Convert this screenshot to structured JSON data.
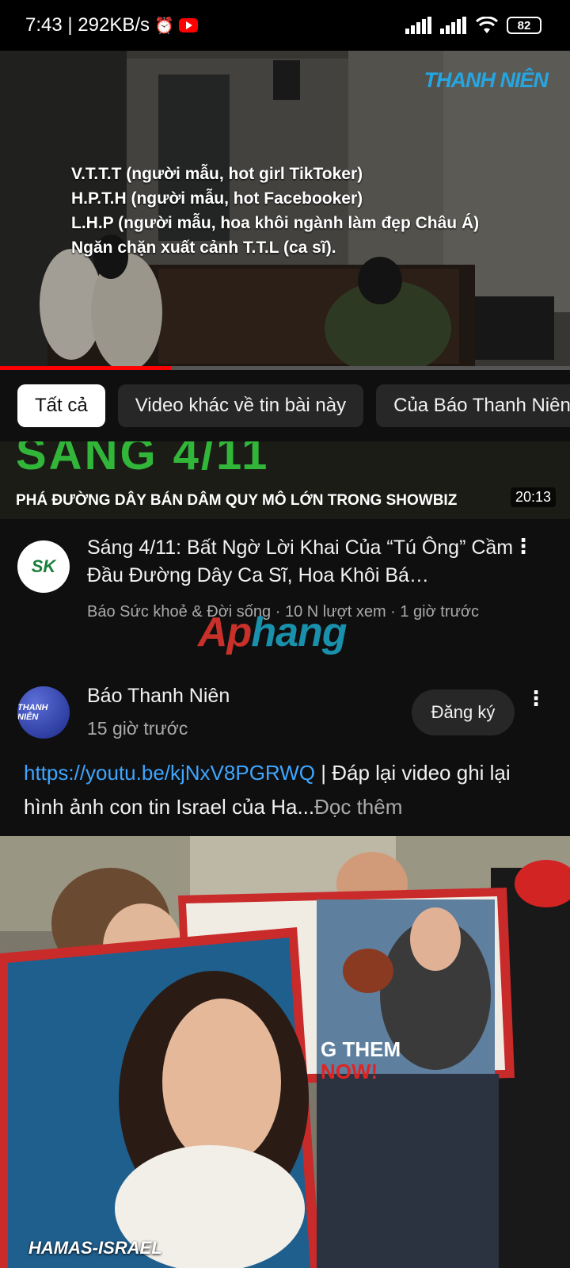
{
  "status_bar": {
    "time_speed": "7:43 | 292KB/s",
    "alarm_icon": "⏰",
    "signal_1": "▂▄▆█",
    "signal_2": "▂▄▆█",
    "wifi_icon": "📶",
    "battery": "82"
  },
  "player": {
    "brand": "THANH NIÊN",
    "overlay_lines": [
      "V.T.T.T (người mẫu, hot girl TikToker)",
      "H.P.T.H (người mẫu, hot Facebooker)",
      "L.H.P (người mẫu, hoa khôi ngành làm đẹp Châu Á)",
      "Ngăn chặn xuất cảnh T.T.L (ca sĩ)."
    ],
    "progress_fraction": 0.3
  },
  "chips": [
    {
      "label": "Tất cả",
      "active": true
    },
    {
      "label": "Video khác về tin bài này",
      "active": false
    },
    {
      "label": "Của Báo Thanh Niên",
      "active": false
    }
  ],
  "thumbnail": {
    "title": "SÁNG 4/11",
    "subtitle": "PHÁ ĐƯỜNG DÂY BÁN DÂM QUY MÔ LỚN TRONG SHOWBIZ",
    "duration": "20:13"
  },
  "video": {
    "channel_avatar": "SK",
    "title": "Sáng 4/11: Bất Ngờ Lời Khai Của “Tú Ông” Cầm Đầu Đường Dây Ca Sĩ, Hoa Khôi Bá…",
    "meta": "Báo Sức khoẻ & Đời sống · 10 N lượt xem · 1 giờ trước"
  },
  "watermark": {
    "part1": "Ap",
    "part2": "hang"
  },
  "post": {
    "avatar_text": "THANH NIÊN",
    "channel": "Báo Thanh Niên",
    "time": "15 giờ trước",
    "subscribe": "Đăng ký",
    "link": "https://youtu.be/kjNxV8PGRWQ",
    "text": " | Đáp lại video ghi lại hình ảnh con tin Israel của Ha...",
    "read_more": "Đọc thêm",
    "image_caption": "HAMAS-ISRAEL",
    "poster_line1": "G THEM",
    "poster_line2": "NOW!"
  },
  "colors": {
    "youtube_red": "#ff0000",
    "link_blue": "#3ea6ff",
    "brand_blue": "#26a6e0"
  }
}
